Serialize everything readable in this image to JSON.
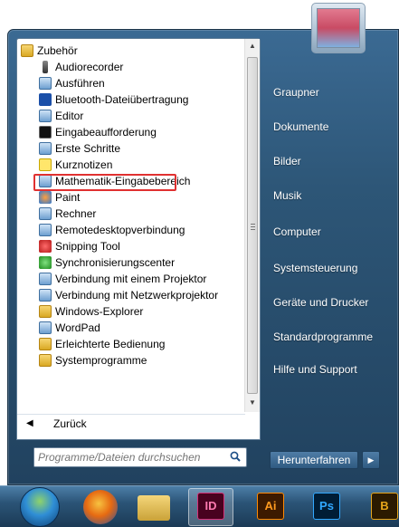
{
  "start_menu": {
    "programs": [
      {
        "label": "Zubehör",
        "icon": "folder-icon",
        "level": 0
      },
      {
        "label": "Audiorecorder",
        "icon": "microphone-icon",
        "level": 1
      },
      {
        "label": "Ausführen",
        "icon": "run-icon",
        "level": 1
      },
      {
        "label": "Bluetooth-Dateiübertragung",
        "icon": "bluetooth-icon",
        "level": 1
      },
      {
        "label": "Editor",
        "icon": "notepad-icon",
        "level": 1
      },
      {
        "label": "Eingabeaufforderung",
        "icon": "command-prompt-icon",
        "level": 1,
        "highlighted": true
      },
      {
        "label": "Erste Schritte",
        "icon": "getting-started-icon",
        "level": 1
      },
      {
        "label": "Kurznotizen",
        "icon": "sticky-notes-icon",
        "level": 1
      },
      {
        "label": "Mathematik-Eingabebereich",
        "icon": "math-input-icon",
        "level": 1
      },
      {
        "label": "Paint",
        "icon": "paint-icon",
        "level": 1
      },
      {
        "label": "Rechner",
        "icon": "calculator-icon",
        "level": 1
      },
      {
        "label": "Remotedesktopverbindung",
        "icon": "remote-desktop-icon",
        "level": 1
      },
      {
        "label": "Snipping Tool",
        "icon": "scissors-icon",
        "level": 1
      },
      {
        "label": "Synchronisierungscenter",
        "icon": "sync-icon",
        "level": 1
      },
      {
        "label": "Verbindung mit einem Projektor",
        "icon": "projector-icon",
        "level": 1
      },
      {
        "label": "Verbindung mit Netzwerkprojektor",
        "icon": "network-projector-icon",
        "level": 1
      },
      {
        "label": "Windows-Explorer",
        "icon": "explorer-folder-icon",
        "level": 1
      },
      {
        "label": "WordPad",
        "icon": "wordpad-icon",
        "level": 1
      },
      {
        "label": "Erleichterte Bedienung",
        "icon": "folder-icon",
        "level": 1
      },
      {
        "label": "Systemprogramme",
        "icon": "folder-icon",
        "level": 1
      }
    ],
    "back_label": "Zurück",
    "search_placeholder": "Programme/Dateien durchsuchen",
    "right_items": [
      "Graupner",
      "Dokumente",
      "Bilder",
      "Musik",
      "Computer",
      "Systemsteuerung",
      "Geräte und Drucker",
      "Standardprogramme",
      "Hilfe und Support"
    ],
    "shutdown_label": "Herunterfahren"
  },
  "taskbar": {
    "apps": [
      {
        "name": "start-button"
      },
      {
        "name": "firefox"
      },
      {
        "name": "windows-explorer"
      },
      {
        "name": "indesign",
        "label": "ID"
      },
      {
        "name": "illustrator",
        "label": "Ai"
      },
      {
        "name": "photoshop",
        "label": "Ps"
      },
      {
        "name": "bridge",
        "label": "B"
      }
    ]
  }
}
